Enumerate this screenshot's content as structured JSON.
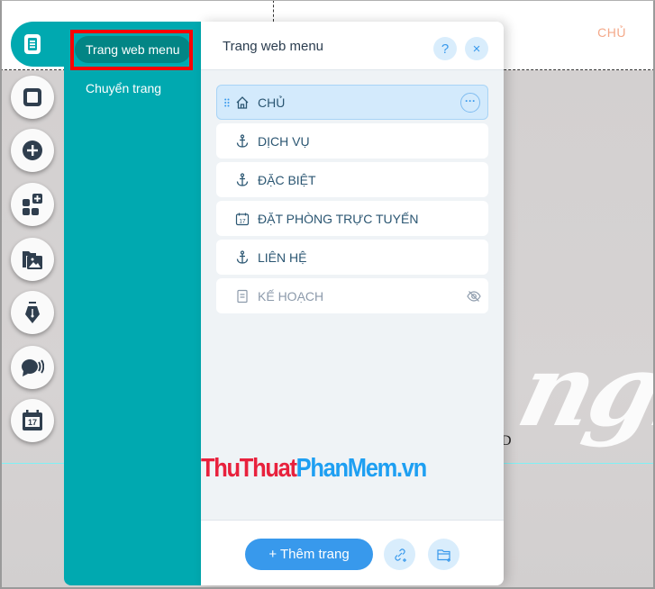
{
  "site": {
    "nav_item": "CHỦ",
    "script_text": "ngh",
    "canvas_char": "D"
  },
  "toolbar": {
    "top_icon": "pages-icon",
    "buttons": [
      {
        "icon": "background-icon",
        "label": "Background"
      },
      {
        "icon": "add-icon",
        "label": "Add"
      },
      {
        "icon": "add-apps-icon",
        "label": "Add Apps"
      },
      {
        "icon": "media-icon",
        "label": "Media"
      },
      {
        "icon": "pen-icon",
        "label": "Blog"
      },
      {
        "icon": "chat-icon",
        "label": "Chat"
      },
      {
        "icon": "calendar-icon",
        "label": "Bookings"
      }
    ]
  },
  "side_nav": {
    "items": [
      {
        "label": "Trang web menu",
        "active": true
      },
      {
        "label": "Chuyển trang",
        "active": false
      }
    ]
  },
  "panel": {
    "title": "Trang web menu",
    "help_label": "?",
    "close_label": "×",
    "pages": [
      {
        "label": "CHỦ",
        "icon": "home-icon",
        "selected": true,
        "hidden": false
      },
      {
        "label": "DỊCH VỤ",
        "icon": "anchor-icon",
        "selected": false,
        "hidden": false
      },
      {
        "label": "ĐẶC BIỆT",
        "icon": "anchor-icon",
        "selected": false,
        "hidden": false
      },
      {
        "label": "ĐẶT PHÒNG TRỰC TUYẾN",
        "icon": "calendar-icon",
        "selected": false,
        "hidden": false
      },
      {
        "label": "LIÊN HỆ",
        "icon": "anchor-icon",
        "selected": false,
        "hidden": false
      },
      {
        "label": "KẾ HOẠCH",
        "icon": "page-icon",
        "selected": false,
        "hidden": true
      }
    ],
    "more_label": "···",
    "add_page_label": "+ Thêm trang",
    "add_link_icon": "add-link-icon",
    "add_folder_icon": "add-folder-icon"
  },
  "watermark": {
    "part1": "ThuThuat",
    "part2": "PhanMem.vn"
  },
  "colors": {
    "teal": "#00a9b0",
    "accent_blue": "#3899ec",
    "highlight_red": "#ff0000"
  }
}
